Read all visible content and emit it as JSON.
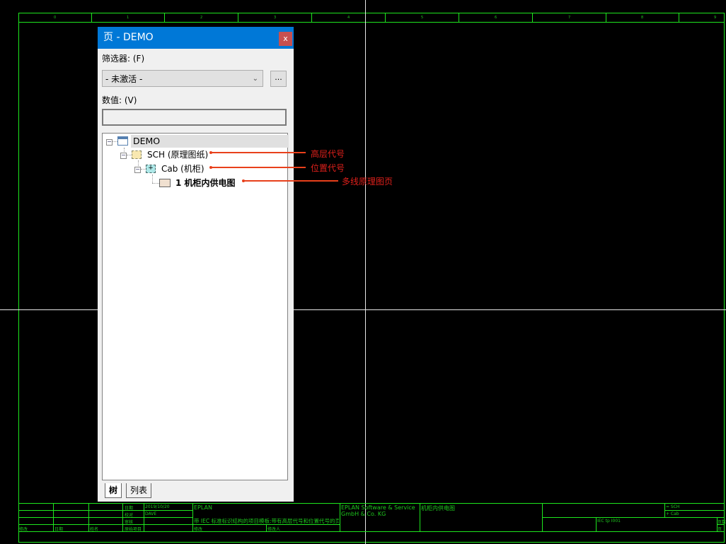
{
  "drawing": {
    "columns": [
      "0",
      "1",
      "2",
      "3",
      "4",
      "5",
      "6",
      "7",
      "8",
      "9"
    ],
    "title_block": {
      "date_label": "日期",
      "date": "2019/10/20",
      "check_label": "校对",
      "checker": "DAVE",
      "review_label": "审核",
      "rev_label": "修改",
      "rev_date_label": "日期",
      "name_label": "姓名",
      "original_label": "原始项目",
      "company": "EPLAN",
      "project_desc": "带 IEC 标准标识结构的项目模板:带有高层代号和位置代号的页结构",
      "mod_label": "修改",
      "mod_by_label": "修改人",
      "maker_line1": "EPLAN Software & Service",
      "maker_line2": "GmbH & Co. KG",
      "page_title": "机柜内供电图",
      "higher_level": "= SCH",
      "location": "+ Cab",
      "page_code": "IEC tp I001",
      "pages_label": "页数",
      "page_label": "页"
    }
  },
  "panel": {
    "title": "页 - DEMO",
    "close": "x",
    "filter_label": "筛选器: (F)",
    "filter_value": "- 未激活 -",
    "more_button": "...",
    "value_label": "数值: (V)",
    "value_input": "",
    "tree": [
      {
        "label": "DEMO",
        "icon": "project-icon",
        "expanded": true
      },
      {
        "label": "SCH (原理图纸)",
        "icon": "higher-level-icon",
        "expanded": true
      },
      {
        "label": "Cab (机柜)",
        "icon": "location-icon",
        "expanded": true
      },
      {
        "label": "1 机柜内供电图",
        "icon": "schematic-page-icon"
      }
    ],
    "tabs": [
      "树",
      "列表"
    ],
    "active_tab": "树"
  },
  "annotations": [
    "高层代号",
    "位置代号",
    "多线原理图页"
  ],
  "colors": {
    "frame": "#1ee61e",
    "titlebar": "#0078d7",
    "annotation": "#e0201b",
    "close": "#c75050"
  }
}
